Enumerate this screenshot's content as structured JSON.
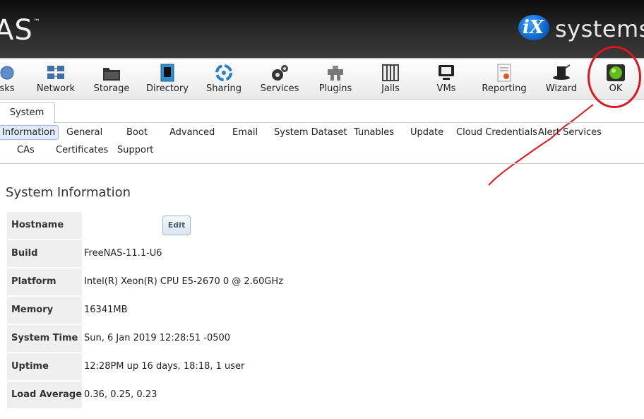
{
  "header": {
    "logo_left": "AS",
    "logo_right_ix": "iX",
    "logo_right_systems": "systems"
  },
  "toolbar": {
    "items": [
      {
        "label": "sks",
        "icon": "tasks-icon"
      },
      {
        "label": "Network",
        "icon": "network-icon"
      },
      {
        "label": "Storage",
        "icon": "storage-icon"
      },
      {
        "label": "Directory",
        "icon": "directory-icon"
      },
      {
        "label": "Sharing",
        "icon": "sharing-icon"
      },
      {
        "label": "Services",
        "icon": "services-icon"
      },
      {
        "label": "Plugins",
        "icon": "plugins-icon"
      },
      {
        "label": "Jails",
        "icon": "jails-icon"
      },
      {
        "label": "VMs",
        "icon": "vms-icon"
      },
      {
        "label": "Reporting",
        "icon": "reporting-icon"
      },
      {
        "label": "Wizard",
        "icon": "wizard-icon"
      },
      {
        "label": "OK",
        "icon": "alert-status-icon"
      }
    ]
  },
  "tabs": {
    "main": "System"
  },
  "subtabs": [
    "Information",
    "General",
    "Boot",
    "Advanced",
    "Email",
    "System Dataset",
    "Tunables",
    "Update",
    "Cloud Credentials",
    "Alert Services",
    "CAs",
    "Certificates",
    "Support"
  ],
  "section_title": "System Information",
  "info": {
    "hostname_label": "Hostname",
    "hostname_value": "",
    "edit_label": "Edit",
    "build_label": "Build",
    "build_value": "FreeNAS-11.1-U6",
    "platform_label": "Platform",
    "platform_value": "Intel(R) Xeon(R) CPU E5-2670 0 @ 2.60GHz",
    "memory_label": "Memory",
    "memory_value": "16341MB",
    "system_time_label": "System Time",
    "system_time_value": "Sun, 6 Jan 2019 12:28:51 -0500",
    "uptime_label": "Uptime",
    "uptime_value": "12:28PM up 16 days, 18:18, 1 user",
    "load_label": "Load Average",
    "load_value": "0.36, 0.25, 0.23"
  },
  "colors": {
    "annotation": "#e0161c",
    "status_ok": "#5fbf1a"
  }
}
